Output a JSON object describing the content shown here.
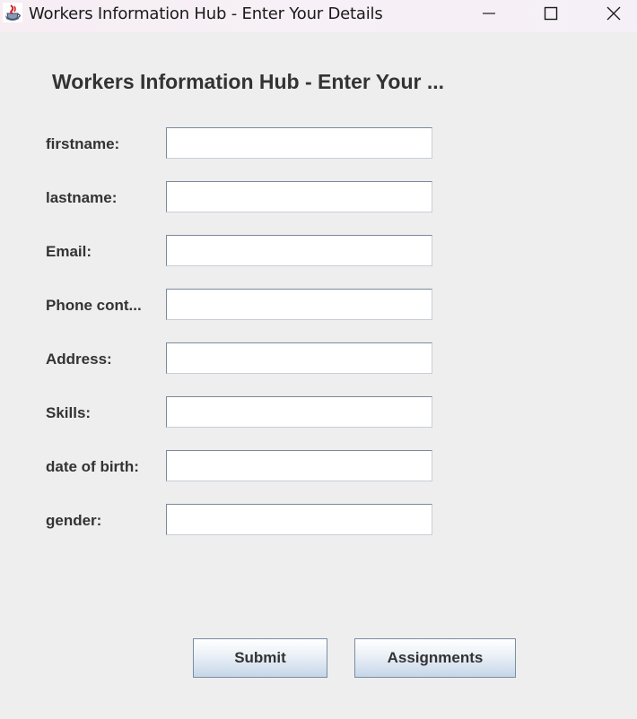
{
  "window": {
    "title": "Workers Information Hub - Enter Your Details",
    "app_icon": "java-coffee-cup-icon",
    "controls": [
      "minimize-icon",
      "maximize-icon",
      "close-icon"
    ]
  },
  "form": {
    "heading": "Workers Information Hub - Enter Your ...",
    "fields": [
      {
        "label": "firstname:",
        "value": ""
      },
      {
        "label": "lastname:",
        "value": ""
      },
      {
        "label": "Email:",
        "value": ""
      },
      {
        "label": "Phone cont...",
        "value": ""
      },
      {
        "label": "Address:",
        "value": ""
      },
      {
        "label": "Skills:",
        "value": ""
      },
      {
        "label": "date of birth:",
        "value": ""
      },
      {
        "label": "gender:",
        "value": ""
      }
    ]
  },
  "buttons": {
    "submit": "Submit",
    "assignments": "Assignments"
  }
}
